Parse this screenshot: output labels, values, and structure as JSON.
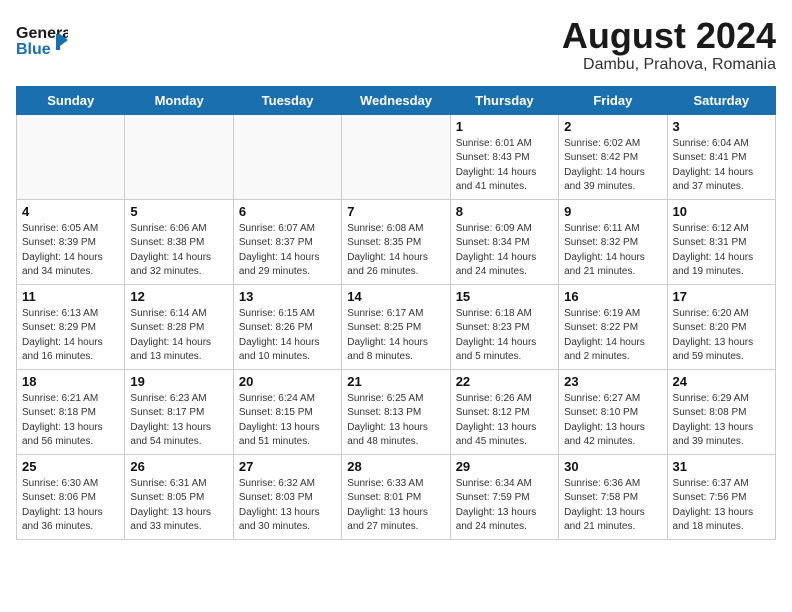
{
  "header": {
    "logo_general": "General",
    "logo_blue": "Blue",
    "title": "August 2024",
    "subtitle": "Dambu, Prahova, Romania"
  },
  "days_of_week": [
    "Sunday",
    "Monday",
    "Tuesday",
    "Wednesday",
    "Thursday",
    "Friday",
    "Saturday"
  ],
  "weeks": [
    [
      {
        "day": "",
        "info": ""
      },
      {
        "day": "",
        "info": ""
      },
      {
        "day": "",
        "info": ""
      },
      {
        "day": "",
        "info": ""
      },
      {
        "day": "1",
        "info": "Sunrise: 6:01 AM\nSunset: 8:43 PM\nDaylight: 14 hours\nand 41 minutes."
      },
      {
        "day": "2",
        "info": "Sunrise: 6:02 AM\nSunset: 8:42 PM\nDaylight: 14 hours\nand 39 minutes."
      },
      {
        "day": "3",
        "info": "Sunrise: 6:04 AM\nSunset: 8:41 PM\nDaylight: 14 hours\nand 37 minutes."
      }
    ],
    [
      {
        "day": "4",
        "info": "Sunrise: 6:05 AM\nSunset: 8:39 PM\nDaylight: 14 hours\nand 34 minutes."
      },
      {
        "day": "5",
        "info": "Sunrise: 6:06 AM\nSunset: 8:38 PM\nDaylight: 14 hours\nand 32 minutes."
      },
      {
        "day": "6",
        "info": "Sunrise: 6:07 AM\nSunset: 8:37 PM\nDaylight: 14 hours\nand 29 minutes."
      },
      {
        "day": "7",
        "info": "Sunrise: 6:08 AM\nSunset: 8:35 PM\nDaylight: 14 hours\nand 26 minutes."
      },
      {
        "day": "8",
        "info": "Sunrise: 6:09 AM\nSunset: 8:34 PM\nDaylight: 14 hours\nand 24 minutes."
      },
      {
        "day": "9",
        "info": "Sunrise: 6:11 AM\nSunset: 8:32 PM\nDaylight: 14 hours\nand 21 minutes."
      },
      {
        "day": "10",
        "info": "Sunrise: 6:12 AM\nSunset: 8:31 PM\nDaylight: 14 hours\nand 19 minutes."
      }
    ],
    [
      {
        "day": "11",
        "info": "Sunrise: 6:13 AM\nSunset: 8:29 PM\nDaylight: 14 hours\nand 16 minutes."
      },
      {
        "day": "12",
        "info": "Sunrise: 6:14 AM\nSunset: 8:28 PM\nDaylight: 14 hours\nand 13 minutes."
      },
      {
        "day": "13",
        "info": "Sunrise: 6:15 AM\nSunset: 8:26 PM\nDaylight: 14 hours\nand 10 minutes."
      },
      {
        "day": "14",
        "info": "Sunrise: 6:17 AM\nSunset: 8:25 PM\nDaylight: 14 hours\nand 8 minutes."
      },
      {
        "day": "15",
        "info": "Sunrise: 6:18 AM\nSunset: 8:23 PM\nDaylight: 14 hours\nand 5 minutes."
      },
      {
        "day": "16",
        "info": "Sunrise: 6:19 AM\nSunset: 8:22 PM\nDaylight: 14 hours\nand 2 minutes."
      },
      {
        "day": "17",
        "info": "Sunrise: 6:20 AM\nSunset: 8:20 PM\nDaylight: 13 hours\nand 59 minutes."
      }
    ],
    [
      {
        "day": "18",
        "info": "Sunrise: 6:21 AM\nSunset: 8:18 PM\nDaylight: 13 hours\nand 56 minutes."
      },
      {
        "day": "19",
        "info": "Sunrise: 6:23 AM\nSunset: 8:17 PM\nDaylight: 13 hours\nand 54 minutes."
      },
      {
        "day": "20",
        "info": "Sunrise: 6:24 AM\nSunset: 8:15 PM\nDaylight: 13 hours\nand 51 minutes."
      },
      {
        "day": "21",
        "info": "Sunrise: 6:25 AM\nSunset: 8:13 PM\nDaylight: 13 hours\nand 48 minutes."
      },
      {
        "day": "22",
        "info": "Sunrise: 6:26 AM\nSunset: 8:12 PM\nDaylight: 13 hours\nand 45 minutes."
      },
      {
        "day": "23",
        "info": "Sunrise: 6:27 AM\nSunset: 8:10 PM\nDaylight: 13 hours\nand 42 minutes."
      },
      {
        "day": "24",
        "info": "Sunrise: 6:29 AM\nSunset: 8:08 PM\nDaylight: 13 hours\nand 39 minutes."
      }
    ],
    [
      {
        "day": "25",
        "info": "Sunrise: 6:30 AM\nSunset: 8:06 PM\nDaylight: 13 hours\nand 36 minutes."
      },
      {
        "day": "26",
        "info": "Sunrise: 6:31 AM\nSunset: 8:05 PM\nDaylight: 13 hours\nand 33 minutes."
      },
      {
        "day": "27",
        "info": "Sunrise: 6:32 AM\nSunset: 8:03 PM\nDaylight: 13 hours\nand 30 minutes."
      },
      {
        "day": "28",
        "info": "Sunrise: 6:33 AM\nSunset: 8:01 PM\nDaylight: 13 hours\nand 27 minutes."
      },
      {
        "day": "29",
        "info": "Sunrise: 6:34 AM\nSunset: 7:59 PM\nDaylight: 13 hours\nand 24 minutes."
      },
      {
        "day": "30",
        "info": "Sunrise: 6:36 AM\nSunset: 7:58 PM\nDaylight: 13 hours\nand 21 minutes."
      },
      {
        "day": "31",
        "info": "Sunrise: 6:37 AM\nSunset: 7:56 PM\nDaylight: 13 hours\nand 18 minutes."
      }
    ]
  ]
}
